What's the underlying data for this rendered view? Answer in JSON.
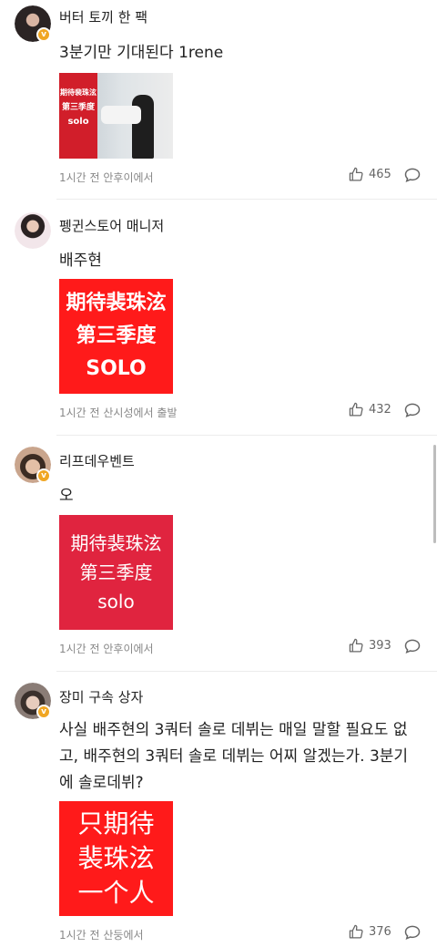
{
  "comments": [
    {
      "username": "버터 토끼 한 팩",
      "text": "3분기만 기대된다 1rene",
      "image_lines": [
        "期待裴珠泫",
        "第三季度",
        "solo"
      ],
      "meta": "1시간 전 안후이에서",
      "likes": "465",
      "avatar_color": "#2b2424"
    },
    {
      "username": "펭귄스토어 매니저",
      "text": "배주현",
      "image_lines": [
        "期待裴珠泫",
        "第三季度",
        "SOLO"
      ],
      "meta": "1시간 전 산시성에서 출발",
      "likes": "432",
      "avatar_color": "#f2e6ea"
    },
    {
      "username": "리프데우벤트",
      "text": "오",
      "image_lines": [
        "期待裴珠泫",
        "第三季度",
        "solo"
      ],
      "meta": "1시간 전 안후이에서",
      "likes": "393",
      "avatar_color": "#c9a58d"
    },
    {
      "username": "장미 구속 상자",
      "text": "사실 배주현의 3쿼터 솔로 데뷔는 매일 말할 필요도 없고, 배주현의 3쿼터 솔로 데뷔는 어찌 알겠는가. 3분기에 솔로데뷔?",
      "image_lines": [
        "只期待",
        "裴珠泫",
        "一个人"
      ],
      "meta": "1시간 전 산둥에서",
      "likes": "376",
      "avatar_color": "#8a7c76"
    }
  ],
  "icons": {
    "like": "thumbs-up-icon",
    "reply": "speech-bubble-icon",
    "verified": "verified-badge-icon"
  },
  "colors": {
    "badge": "#f0a623",
    "red_image": "#ff1a1a",
    "pink_image": "#e0243f"
  }
}
